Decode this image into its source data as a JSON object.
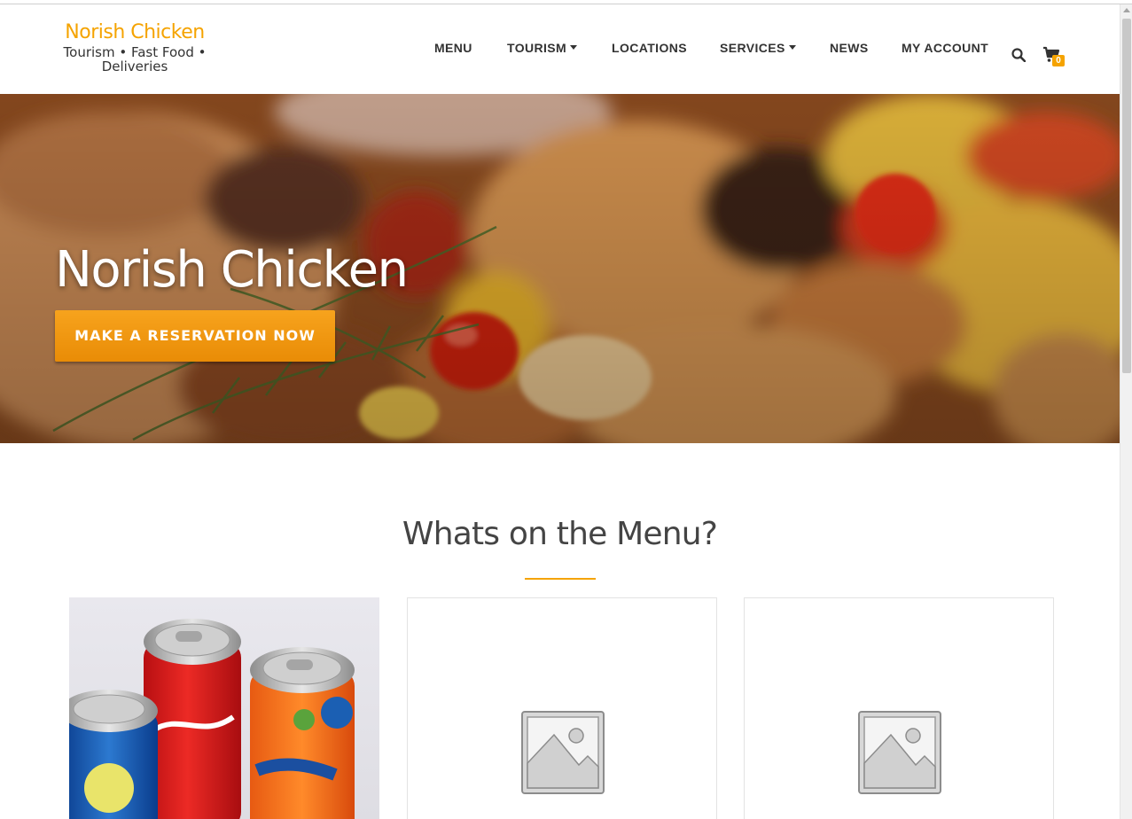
{
  "brand": {
    "name": "Norish Chicken",
    "tagline_line1": "Tourism • Fast Food •",
    "tagline_line2": "Deliveries"
  },
  "nav": {
    "items": [
      {
        "label": "MENU",
        "dropdown": false
      },
      {
        "label": "TOURISM",
        "dropdown": true
      },
      {
        "label": "LOCATIONS",
        "dropdown": false
      },
      {
        "label": "SERVICES",
        "dropdown": true
      },
      {
        "label": "NEWS",
        "dropdown": false
      },
      {
        "label": "MY ACCOUNT",
        "dropdown": false
      }
    ],
    "cart_count": "0"
  },
  "hero": {
    "title": "Norish Chicken",
    "cta_label": "MAKE A RESERVATION NOW"
  },
  "menu_section": {
    "title": "Whats on the Menu?",
    "cards": [
      {
        "image": "soda-cans-photo"
      },
      {
        "image": "placeholder-image-icon"
      },
      {
        "image": "placeholder-image-icon"
      }
    ]
  },
  "colors": {
    "accent": "#f5a300",
    "button": "#ef960e",
    "text_dark": "#333333"
  }
}
